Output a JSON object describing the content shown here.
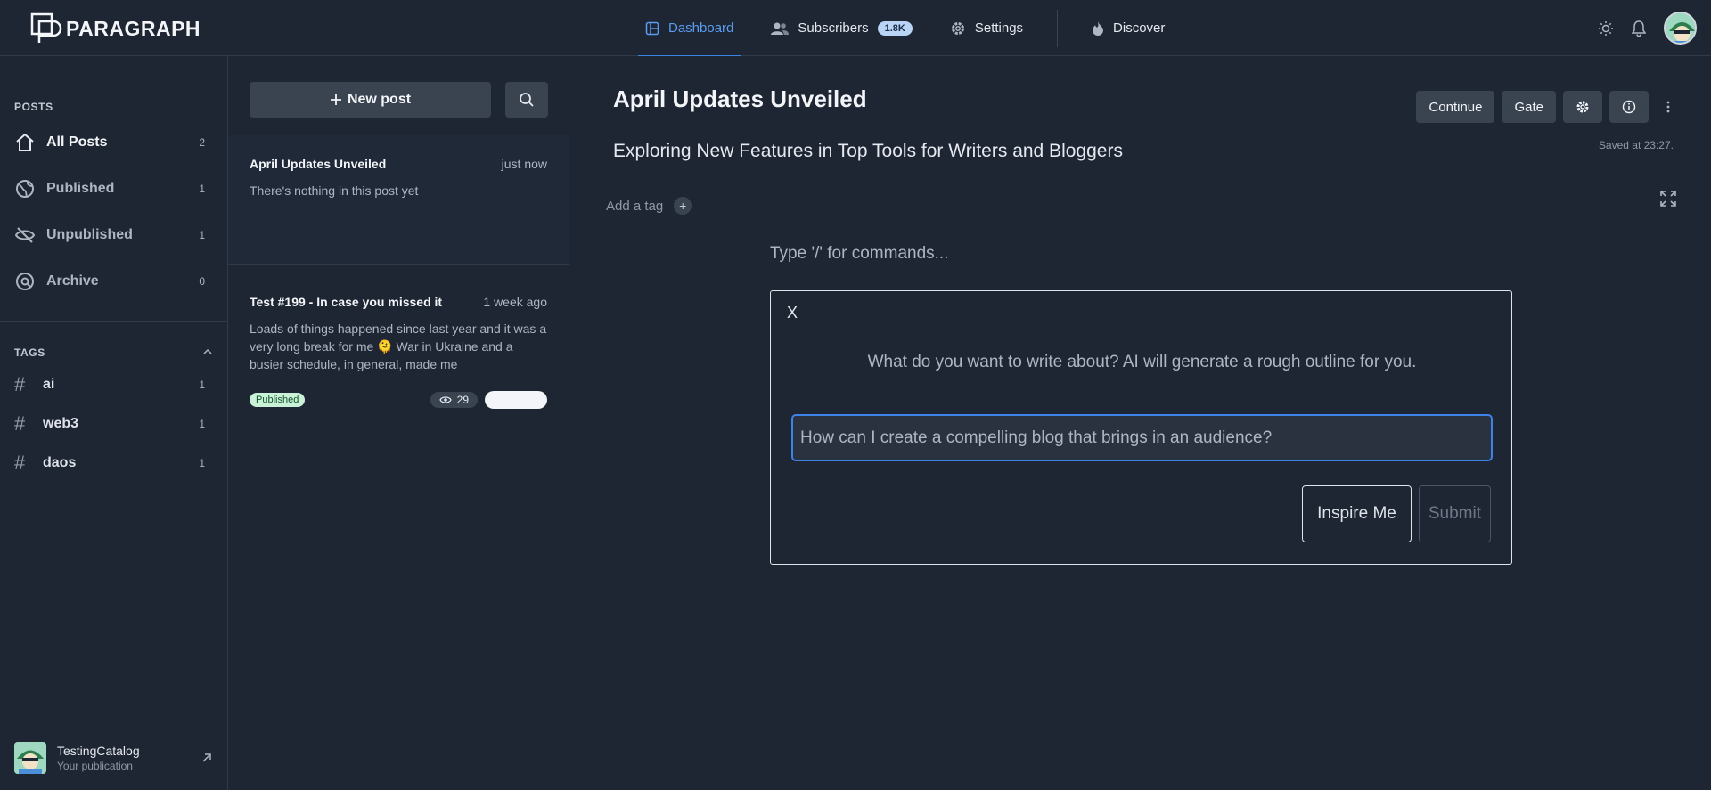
{
  "brand": {
    "logo_text": "PARAGRAPH"
  },
  "nav": {
    "dashboard": "Dashboard",
    "subscribers": "Subscribers",
    "subscribers_count": "1.8K",
    "settings": "Settings",
    "discover": "Discover"
  },
  "sidebar": {
    "posts_label": "POSTS",
    "items": [
      {
        "label": "All Posts",
        "count": "2",
        "icon": "home-icon"
      },
      {
        "label": "Published",
        "count": "1",
        "icon": "globe-icon"
      },
      {
        "label": "Unpublished",
        "count": "1",
        "icon": "eye-off-icon"
      },
      {
        "label": "Archive",
        "count": "0",
        "icon": "archive-icon"
      }
    ],
    "tags_label": "TAGS",
    "tags": [
      {
        "label": "ai",
        "count": "1"
      },
      {
        "label": "web3",
        "count": "1"
      },
      {
        "label": "daos",
        "count": "1"
      }
    ],
    "publication": {
      "name": "TestingCatalog",
      "subtitle": "Your publication"
    }
  },
  "postlist": {
    "new_post": "New post",
    "posts": [
      {
        "title": "April Updates Unveiled",
        "time": "just now",
        "excerpt": "There's nothing in this post yet"
      },
      {
        "title": "Test #199 - In case you missed it",
        "time": "1 week ago",
        "excerpt": "Loads of things happened since last year and it was a very long break for me 🫠 War in Ukraine and a busier schedule, in general, made me",
        "status": "Published",
        "views": "29"
      }
    ]
  },
  "editor": {
    "title": "April Updates Unveiled",
    "subtitle": "Exploring New Features in Top Tools for Writers and Bloggers",
    "continue": "Continue",
    "gate": "Gate",
    "saved": "Saved at 23:27.",
    "add_tag": "Add a tag",
    "add_tag_plus": "+",
    "command_placeholder": "Type '/' for commands...",
    "ai": {
      "close": "X",
      "prompt": "What do you want to write about? AI will generate a rough outline for you.",
      "input_placeholder": "How can I create a compelling blog that brings in an audience?",
      "inspire": "Inspire Me",
      "submit": "Submit"
    }
  }
}
